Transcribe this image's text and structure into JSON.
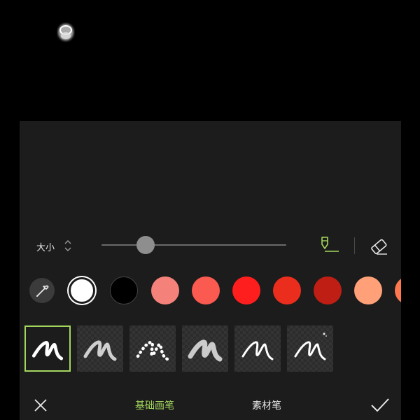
{
  "size_control": {
    "label": "大小",
    "slider_level": 0.21
  },
  "tools": {
    "highlighter_icon": "highlighter-icon",
    "eraser_icon": "eraser-icon",
    "active_color": "#a4d65e"
  },
  "colors": {
    "eyedropper_icon": "eyedropper-icon",
    "selected": "#ffffff",
    "swatches": [
      "#ffffff",
      "#000000",
      "#f5827a",
      "#fa5a50",
      "#ff1e1e",
      "#eb2d1e",
      "#be1e14",
      "#ffa078",
      "#ff7850"
    ]
  },
  "brushes": [
    {
      "name": "solid-pen",
      "selected": true
    },
    {
      "name": "rough-pen",
      "selected": false
    },
    {
      "name": "dotted-pen",
      "selected": false
    },
    {
      "name": "soft-pen",
      "selected": false
    },
    {
      "name": "calligraphy-pen",
      "selected": false
    },
    {
      "name": "neon-pen",
      "selected": false
    }
  ],
  "bottom_bar": {
    "cancel_icon": "close-icon",
    "tab_basic": "基础画笔",
    "tab_material": "素材笔",
    "confirm_icon": "check-icon",
    "active_tab_color": "#a4d65e"
  }
}
